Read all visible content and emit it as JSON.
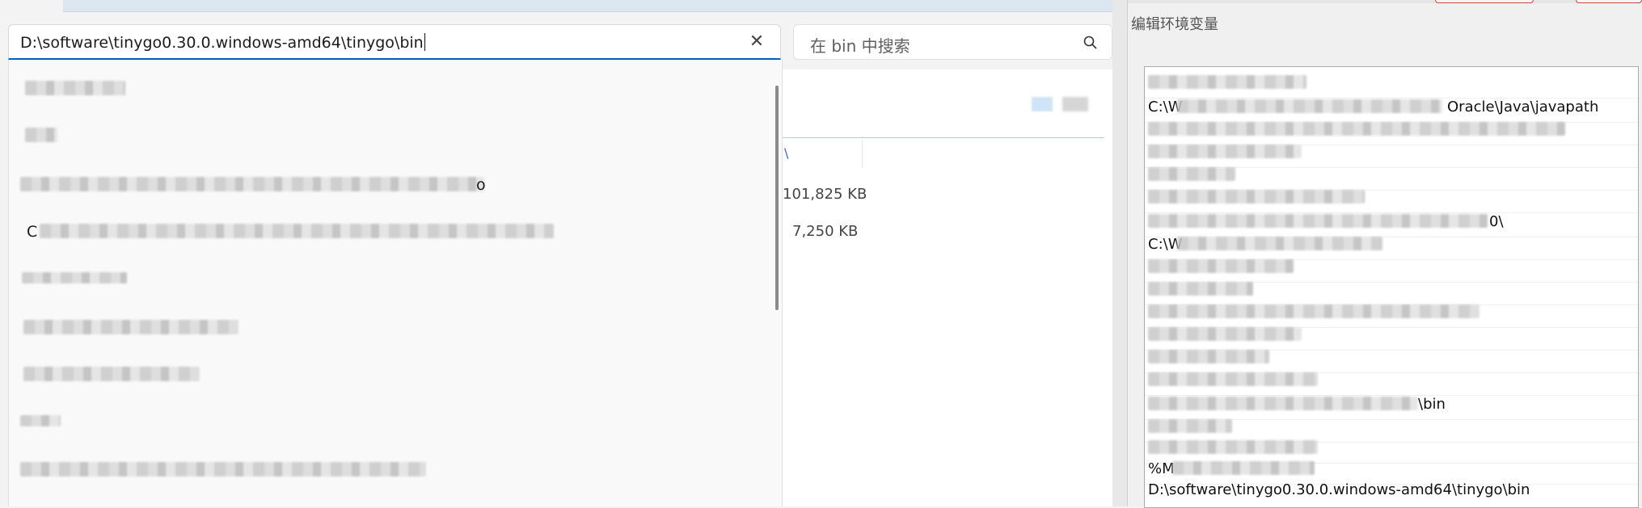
{
  "address_bar": {
    "path": "D:\\software\\tinygo0.30.0.windows-amd64\\tinygo\\bin"
  },
  "search": {
    "placeholder": "在 bin 中搜索"
  },
  "dropdown": {
    "items": [
      {
        "prefix": "",
        "suffix": ""
      },
      {
        "prefix": "",
        "suffix": ""
      },
      {
        "prefix": "",
        "suffix": "o"
      },
      {
        "prefix": "C",
        "suffix": ""
      },
      {
        "prefix": "",
        "suffix": ""
      },
      {
        "prefix": "",
        "suffix": ""
      },
      {
        "prefix": "",
        "suffix": ""
      },
      {
        "prefix": "",
        "suffix": ""
      },
      {
        "prefix": "",
        "suffix": ""
      }
    ]
  },
  "file_list": {
    "column_fragment": "\\",
    "rows": [
      {
        "size": "101,825 KB"
      },
      {
        "size": "7,250 KB"
      }
    ]
  },
  "env_dialog": {
    "title": "编辑环境变量",
    "rows": [
      {
        "prefix": "",
        "suffix": ""
      },
      {
        "prefix": "C:\\W",
        "suffix": "Oracle\\Java\\javapath"
      },
      {
        "prefix": "",
        "suffix": ""
      },
      {
        "prefix": "",
        "suffix": ""
      },
      {
        "prefix": "",
        "suffix": ""
      },
      {
        "prefix": "",
        "suffix": ""
      },
      {
        "prefix": "",
        "suffix": "0\\"
      },
      {
        "prefix": "C:\\W",
        "suffix": ""
      },
      {
        "prefix": "",
        "suffix": ""
      },
      {
        "prefix": "",
        "suffix": ""
      },
      {
        "prefix": "",
        "suffix": ""
      },
      {
        "prefix": "",
        "suffix": ""
      },
      {
        "prefix": "",
        "suffix": ""
      },
      {
        "prefix": "",
        "suffix": ""
      },
      {
        "prefix": "",
        "suffix": "\\bin"
      },
      {
        "prefix": "",
        "suffix": ""
      },
      {
        "prefix": "",
        "suffix": ""
      },
      {
        "prefix": "%M",
        "suffix": ""
      }
    ],
    "last_entry": "D:\\software\\tinygo0.30.0.windows-amd64\\tinygo\\bin"
  },
  "colors": {
    "accent": "#005fb8",
    "panel_bg": "#f9f9f9"
  }
}
